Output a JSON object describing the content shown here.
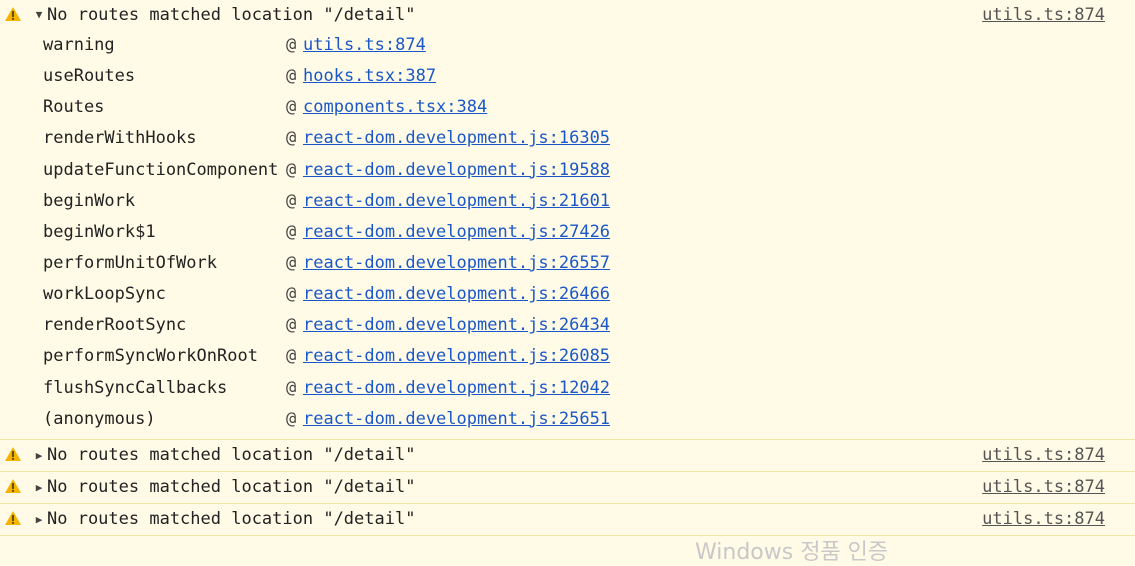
{
  "entries": [
    {
      "message": "No routes matched location \"/detail\"",
      "source": "utils.ts:874",
      "expanded": true,
      "stack": [
        {
          "fn": "warning",
          "file": "utils.ts:874"
        },
        {
          "fn": "useRoutes",
          "file": "hooks.tsx:387"
        },
        {
          "fn": "Routes",
          "file": "components.tsx:384"
        },
        {
          "fn": "renderWithHooks",
          "file": "react-dom.development.js:16305"
        },
        {
          "fn": "updateFunctionComponent",
          "file": "react-dom.development.js:19588"
        },
        {
          "fn": "beginWork",
          "file": "react-dom.development.js:21601"
        },
        {
          "fn": "beginWork$1",
          "file": "react-dom.development.js:27426"
        },
        {
          "fn": "performUnitOfWork",
          "file": "react-dom.development.js:26557"
        },
        {
          "fn": "workLoopSync",
          "file": "react-dom.development.js:26466"
        },
        {
          "fn": "renderRootSync",
          "file": "react-dom.development.js:26434"
        },
        {
          "fn": "performSyncWorkOnRoot",
          "file": "react-dom.development.js:26085"
        },
        {
          "fn": "flushSyncCallbacks",
          "file": "react-dom.development.js:12042"
        },
        {
          "fn": "(anonymous)",
          "file": "react-dom.development.js:25651"
        }
      ]
    },
    {
      "message": "No routes matched location \"/detail\"",
      "source": "utils.ts:874",
      "expanded": false
    },
    {
      "message": "No routes matched location \"/detail\"",
      "source": "utils.ts:874",
      "expanded": false
    },
    {
      "message": "No routes matched location \"/detail\"",
      "source": "utils.ts:874",
      "expanded": false
    }
  ],
  "at_symbol": "@",
  "arrow_expanded": "▼",
  "arrow_collapsed": "▶",
  "watermark": "Windows 정품 인증",
  "colors": {
    "background": "#fffbe6",
    "warning_icon": "#f5b400",
    "link": "#1a57c9"
  },
  "icons": {
    "warning": "warning-icon"
  }
}
